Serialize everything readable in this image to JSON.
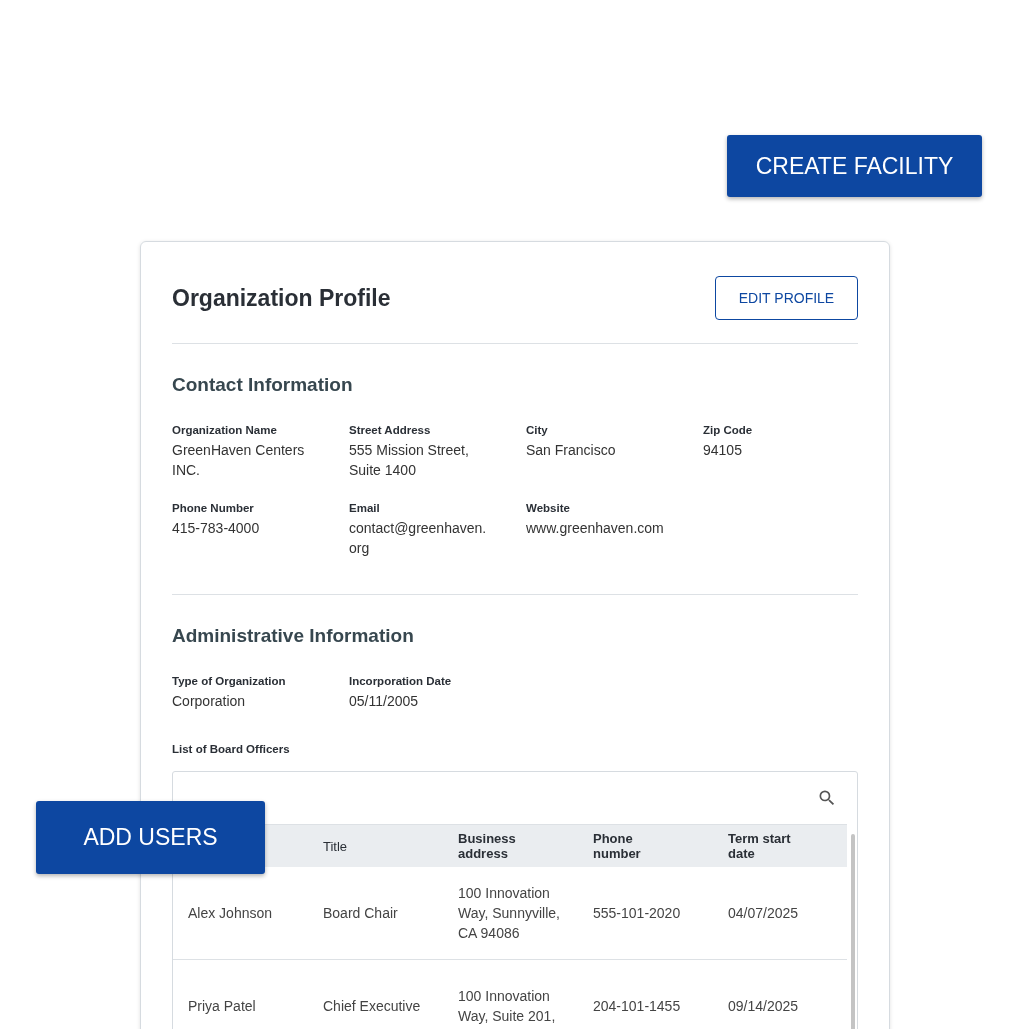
{
  "create_button": "CREATE FACILITY",
  "add_users_button": "ADD USERS",
  "card": {
    "title": "Organization Profile",
    "edit_button": "EDIT PROFILE",
    "sections": [
      {
        "title": "Contact Information",
        "rows": [
          [
            {
              "label": "Organization Name",
              "value": "GreenHaven Centers INC."
            },
            {
              "label": "Street Address",
              "value": "555 Mission Street, Suite 1400"
            },
            {
              "label": "City",
              "value": "San Francisco"
            },
            {
              "label": "Zip Code",
              "value": "94105"
            }
          ],
          [
            {
              "label": "Phone Number",
              "value": "415-783-4000"
            },
            {
              "label": "Email",
              "value": "contact@greenhaven.org"
            },
            {
              "label": "Website",
              "value": "www.greenhaven.com"
            }
          ]
        ]
      },
      {
        "title": "Administrative Information",
        "rows": [
          [
            {
              "label": "Type of Organization",
              "value": "Corporation"
            },
            {
              "label": "Incorporation Date",
              "value": "05/11/2005"
            }
          ]
        ]
      }
    ],
    "board": {
      "label": "List of Board Officers",
      "columns": [
        "",
        "Title",
        "Business address",
        "Phone number",
        "Term start date"
      ],
      "rows": [
        [
          "Alex Johnson",
          "Board Chair",
          "100 Innovation Way, Sunnyville, CA 94086",
          "555-101-2020",
          "04/07/2025"
        ],
        [
          "Priya Patel",
          "Chief Executive",
          "100 Innovation Way, Suite 201,",
          "204-101-1455",
          "09/14/2025"
        ]
      ]
    }
  }
}
